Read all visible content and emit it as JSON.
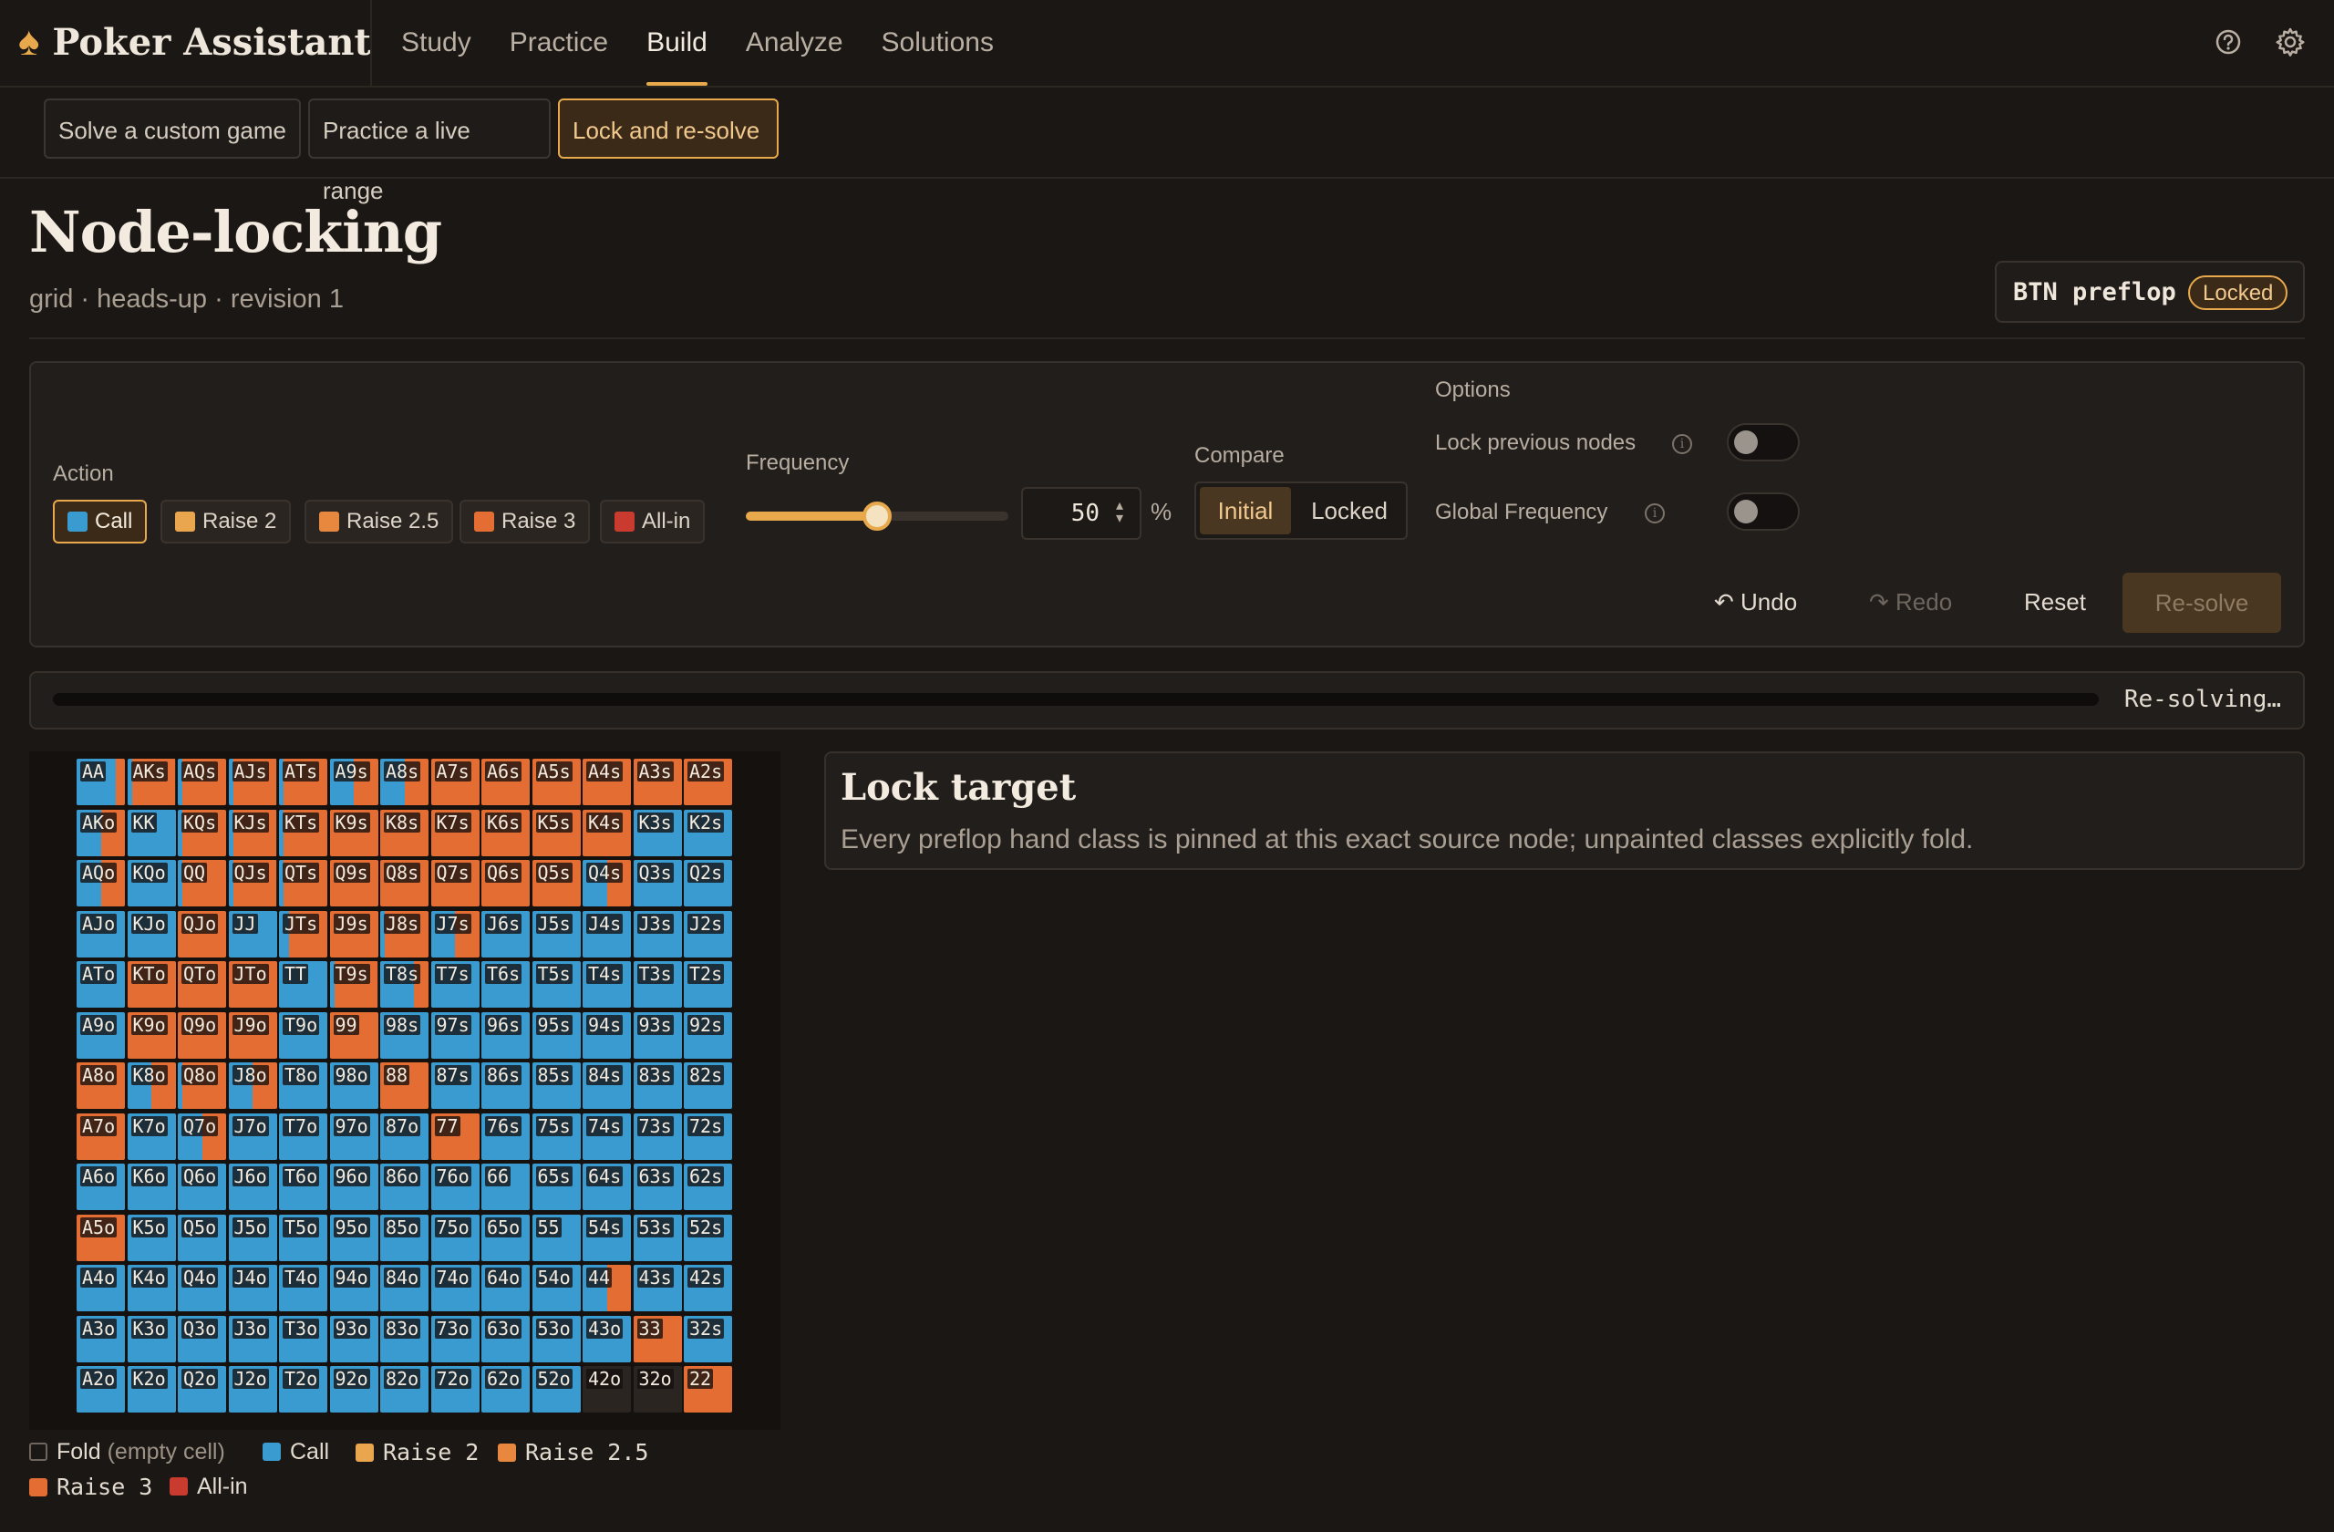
{
  "app": {
    "brand": "Poker Assistant"
  },
  "nav": {
    "items": [
      {
        "label": "Study",
        "active": false
      },
      {
        "label": "Practice",
        "active": false
      },
      {
        "label": "Build",
        "active": true
      },
      {
        "label": "Analyze",
        "active": false
      },
      {
        "label": "Solutions",
        "active": false
      }
    ],
    "icons": [
      "help-icon",
      "settings-icon"
    ]
  },
  "subtabs": [
    {
      "label": "Solve a custom game",
      "active": false
    },
    {
      "label": "Practice a live range",
      "active": false
    },
    {
      "label": "Lock and re-solve",
      "active": true
    }
  ],
  "page": {
    "title": "Node-locking",
    "subtitle": "grid · heads-up · revision 1",
    "node": {
      "name": "BTN preflop",
      "status": "Locked"
    }
  },
  "controls": {
    "action_label": "Action",
    "actions": [
      {
        "label": "Call",
        "color": "#3a9bd0",
        "active": true
      },
      {
        "label": "Raise 2",
        "color": "#e9a64e",
        "active": false
      },
      {
        "label": "Raise 2.5",
        "color": "#e8883e",
        "active": false
      },
      {
        "label": "Raise 3",
        "color": "#e36d32",
        "active": false
      },
      {
        "label": "All-in",
        "color": "#c93b2f",
        "active": false
      }
    ],
    "frequency_label": "Frequency",
    "frequency_value": "50",
    "frequency_fraction": 0.5,
    "frequency_unit": "%",
    "compare_label": "Compare",
    "compare_options": [
      {
        "label": "Initial",
        "active": true
      },
      {
        "label": "Locked",
        "active": false
      }
    ],
    "options_label": "Options",
    "options": [
      {
        "label": "Lock previous nodes",
        "on": false
      },
      {
        "label": "Global Frequency",
        "on": false
      }
    ],
    "undo": "↶ Undo",
    "redo": "↷ Redo",
    "reset": "Reset",
    "resolve": "Re-solve"
  },
  "progress": {
    "text": "Re-solving…",
    "fraction": 0
  },
  "grid": {
    "colors": {
      "call": "#3a9bd0",
      "raise2": "#e9a64e",
      "raise25": "#e8883e",
      "raise3": "#e36d32",
      "allin": "#c93b2f",
      "fold": "#2a2521"
    },
    "selected": "AKo",
    "rows": [
      [
        "AA",
        "AKs",
        "AQs",
        "AJs",
        "ATs",
        "A9s",
        "A8s",
        "A7s",
        "A6s",
        "A5s",
        "A4s",
        "A3s",
        "A2s"
      ],
      [
        "AKo",
        "KK",
        "KQs",
        "KJs",
        "KTs",
        "K9s",
        "K8s",
        "K7s",
        "K6s",
        "K5s",
        "K4s",
        "K3s",
        "K2s"
      ],
      [
        "AQo",
        "KQo",
        "QQ",
        "QJs",
        "QTs",
        "Q9s",
        "Q8s",
        "Q7s",
        "Q6s",
        "Q5s",
        "Q4s",
        "Q3s",
        "Q2s"
      ],
      [
        "AJo",
        "KJo",
        "QJo",
        "JJ",
        "JTs",
        "J9s",
        "J8s",
        "J7s",
        "J6s",
        "J5s",
        "J4s",
        "J3s",
        "J2s"
      ],
      [
        "ATo",
        "KTo",
        "QTo",
        "JTo",
        "TT",
        "T9s",
        "T8s",
        "T7s",
        "T6s",
        "T5s",
        "T4s",
        "T3s",
        "T2s"
      ],
      [
        "A9o",
        "K9o",
        "Q9o",
        "J9o",
        "T9o",
        "99",
        "98s",
        "97s",
        "96s",
        "95s",
        "94s",
        "93s",
        "92s"
      ],
      [
        "A8o",
        "K8o",
        "Q8o",
        "J8o",
        "T8o",
        "98o",
        "88",
        "87s",
        "86s",
        "85s",
        "84s",
        "83s",
        "82s"
      ],
      [
        "A7o",
        "K7o",
        "Q7o",
        "J7o",
        "T7o",
        "97o",
        "87o",
        "77",
        "76s",
        "75s",
        "74s",
        "73s",
        "72s"
      ],
      [
        "A6o",
        "K6o",
        "Q6o",
        "J6o",
        "T6o",
        "96o",
        "86o",
        "76o",
        "66",
        "65s",
        "64s",
        "63s",
        "62s"
      ],
      [
        "A5o",
        "K5o",
        "Q5o",
        "J5o",
        "T5o",
        "95o",
        "85o",
        "75o",
        "65o",
        "55",
        "54s",
        "53s",
        "52s"
      ],
      [
        "A4o",
        "K4o",
        "Q4o",
        "J4o",
        "T4o",
        "94o",
        "84o",
        "74o",
        "64o",
        "54o",
        "44",
        "43s",
        "42s"
      ],
      [
        "A3o",
        "K3o",
        "Q3o",
        "J3o",
        "T3o",
        "93o",
        "83o",
        "73o",
        "63o",
        "53o",
        "43o",
        "33",
        "32s"
      ],
      [
        "A2o",
        "K2o",
        "Q2o",
        "J2o",
        "T2o",
        "92o",
        "82o",
        "72o",
        "62o",
        "52o",
        "42o",
        "32o",
        "22"
      ]
    ],
    "mix": [
      [
        "B2",
        "C1R3",
        "C1R3",
        "C1R3",
        "C1R3",
        "C5R5",
        "C5R5",
        "R3",
        "R3",
        "R3",
        "R3",
        "R3",
        "R3"
      ],
      [
        "C5R5",
        "C",
        "C1R3",
        "C1R3",
        "C1R3",
        "R3",
        "R3",
        "R3",
        "R3",
        "R3",
        "R3",
        "C",
        "C"
      ],
      [
        "C5R5",
        "C",
        "C1R3",
        "C1R3",
        "C1R3",
        "R3",
        "R3",
        "R3",
        "R3",
        "R3",
        "C5R5",
        "C",
        "C"
      ],
      [
        "C",
        "C",
        "R3",
        "C",
        "C2R3",
        "R3",
        "C1R3",
        "C5R5",
        "C",
        "C",
        "C",
        "C",
        "C"
      ],
      [
        "C",
        "R3",
        "R3",
        "R3",
        "C",
        "C1R3",
        "C7R3",
        "C",
        "C",
        "C",
        "C",
        "C",
        "C"
      ],
      [
        "C",
        "R3",
        "R3",
        "R3",
        "C",
        "R3",
        "C",
        "C",
        "C",
        "C",
        "C",
        "C",
        "C"
      ],
      [
        "R3",
        "C5R5",
        "C1R3",
        "C5R5",
        "C",
        "C",
        "R3",
        "C",
        "C",
        "C",
        "C",
        "C",
        "C"
      ],
      [
        "R3",
        "C",
        "C5R5",
        "C",
        "C",
        "C",
        "C",
        "R3",
        "C",
        "C",
        "C",
        "C",
        "C"
      ],
      [
        "C",
        "C",
        "C",
        "C",
        "C",
        "C",
        "C",
        "C",
        "C",
        "C",
        "C",
        "C",
        "C"
      ],
      [
        "R3",
        "C",
        "C",
        "C",
        "C",
        "C",
        "C",
        "C",
        "C",
        "C",
        "C",
        "C",
        "C"
      ],
      [
        "C",
        "C",
        "C",
        "C",
        "C",
        "C",
        "C",
        "C",
        "C",
        "C",
        "C5R5",
        "C",
        "C"
      ],
      [
        "C",
        "C",
        "C",
        "C",
        "C",
        "C",
        "C",
        "C",
        "C",
        "C",
        "C",
        "R3",
        "C"
      ],
      [
        "C",
        "C",
        "C",
        "C",
        "C",
        "C",
        "C",
        "C",
        "C",
        "C",
        "F",
        "F",
        "R3"
      ]
    ]
  },
  "legend": {
    "items": [
      {
        "label": "Fold",
        "note": "(empty cell)",
        "color": "#1b1714"
      },
      {
        "label": "Call",
        "note": "",
        "color": "#3a9bd0"
      },
      {
        "label": "Raise 2",
        "note": "",
        "color": "#e9a64e"
      },
      {
        "label": "Raise 2.5",
        "note": "",
        "color": "#e8883e"
      },
      {
        "label": "Raise 3",
        "note": "",
        "color": "#e36d32"
      },
      {
        "label": "All-in",
        "note": "",
        "color": "#c93b2f"
      }
    ]
  },
  "lock_target": {
    "title": "Lock target",
    "text": "Every preflop hand class is pinned at this exact source node; unpainted classes explicitly fold."
  }
}
